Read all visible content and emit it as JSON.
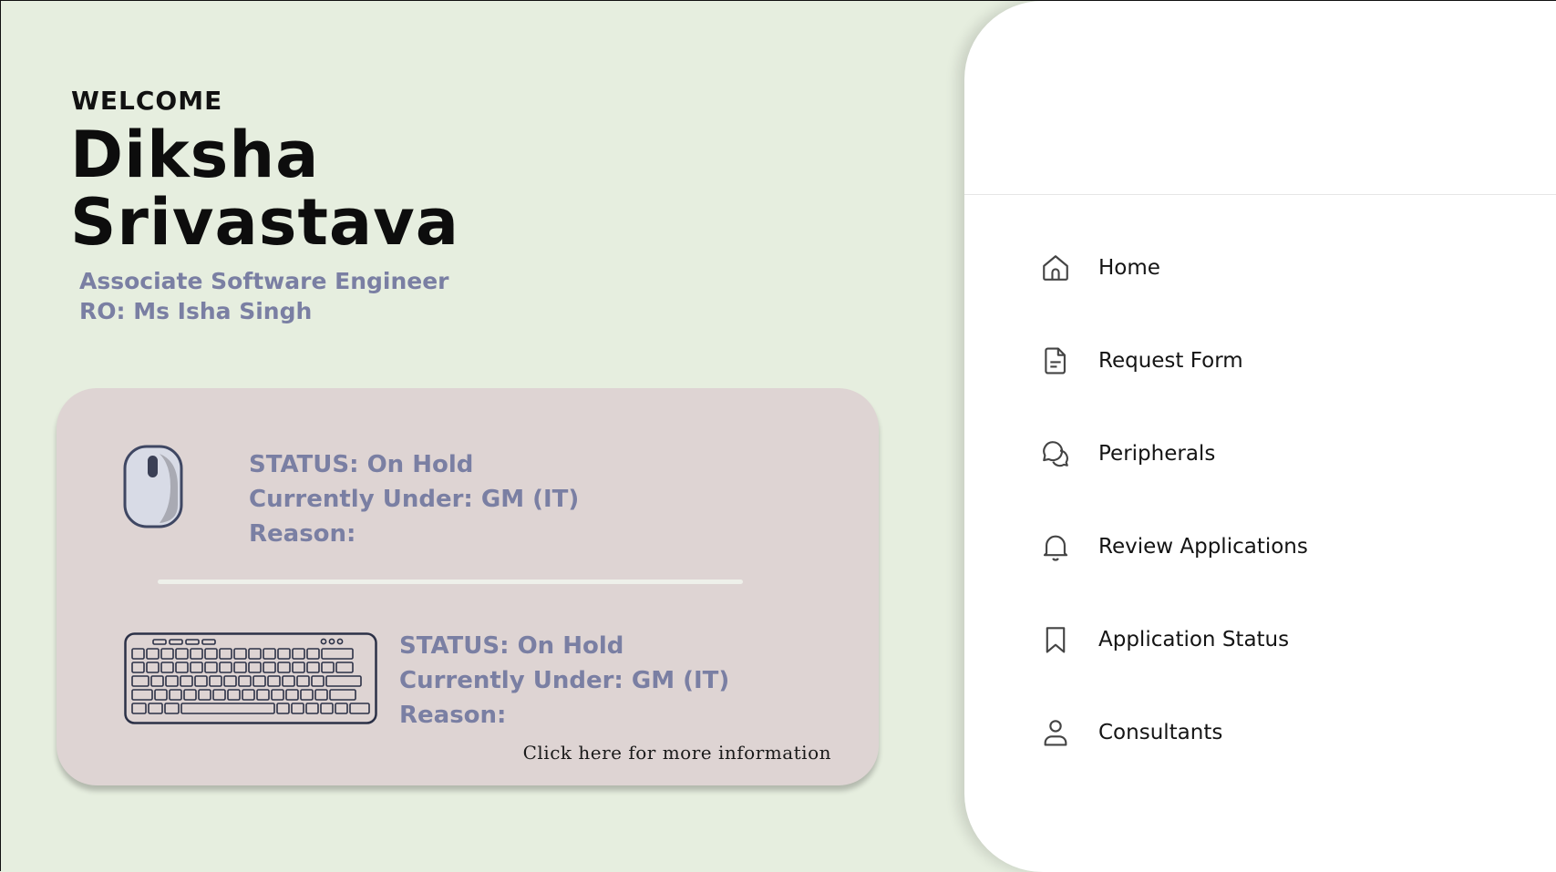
{
  "welcome": "WELCOME",
  "user": {
    "first_name": "Diksha",
    "last_name": "Srivastava",
    "designation": "Associate Software Engineer",
    "ro": "RO: Ms Isha Singh"
  },
  "requests": [
    {
      "icon": "mouse-icon",
      "status": "STATUS: On Hold",
      "under": "Currently Under: GM (IT)",
      "reason": "Reason:"
    },
    {
      "icon": "keyboard-icon",
      "status": "STATUS: On Hold",
      "under": "Currently Under: GM (IT)",
      "reason": "Reason:"
    }
  ],
  "more_info": "Click here for more information",
  "nav": [
    {
      "label": "Home",
      "icon": "home-icon"
    },
    {
      "label": "Request Form",
      "icon": "document-icon"
    },
    {
      "label": "Peripherals",
      "icon": "chat-bubbles-icon"
    },
    {
      "label": "Review Applications",
      "icon": "bell-icon"
    },
    {
      "label": "Application Status",
      "icon": "bookmark-icon"
    },
    {
      "label": "Consultants",
      "icon": "user-icon"
    }
  ],
  "colors": {
    "background": "#e6eedf",
    "card": "#ded4d3",
    "status_text": "#7a7fa3",
    "sidebar": "#ffffff"
  }
}
